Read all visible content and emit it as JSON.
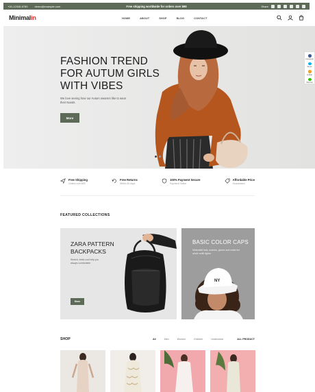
{
  "topbar": {
    "phone": "+00-12345-6789",
    "email": "demo@example.com",
    "promo": "Free shipping worldwide for orders over $99",
    "share_label": "Share"
  },
  "header": {
    "logo_main": "Minimal",
    "logo_accent": "in",
    "nav": [
      "HOME",
      "ABOUT",
      "SHOP",
      "BLOG",
      "CONTACT"
    ]
  },
  "hero": {
    "title_lines": [
      "FASHION TREND",
      "FOR AUTUM GIRLS",
      "WITH VIBES"
    ],
    "subtitle": "We love seeing how our Autum wearers like to wear their Nands",
    "button": "More"
  },
  "side_widget": {
    "items": [
      "Facebook",
      "Skype",
      "E-Mail",
      "WeChat"
    ]
  },
  "features": [
    {
      "title": "Free Shipping",
      "sub": "Orders over $99"
    },
    {
      "title": "Free Returns",
      "sub": "Within 30 days"
    },
    {
      "title": "100% Payment Secure",
      "sub": "Payment Online"
    },
    {
      "title": "Affordable Price",
      "sub": "Guaranteed"
    }
  ],
  "featured": {
    "title": "FEATURED COLLECTIONS",
    "card1": {
      "title_lines": [
        "ZARA PATTERN",
        "BACKPACKS"
      ],
      "desc": "Stretch, fresh-cool help you always comfortable",
      "button": "More"
    },
    "card2": {
      "title": "BASIC COLOR CAPS",
      "desc": "Minimalist hats, scarves, gloves and make the whole outfit lighter"
    }
  },
  "shop": {
    "title": "SHOP",
    "filters": [
      "All",
      "Men",
      "Women",
      "Children",
      "Underwear"
    ],
    "all_products": "ALL PRODUCT"
  },
  "colors": {
    "accent": "#5d6a57",
    "logo_accent": "#dd3333",
    "hero_bg": "#ededed"
  }
}
